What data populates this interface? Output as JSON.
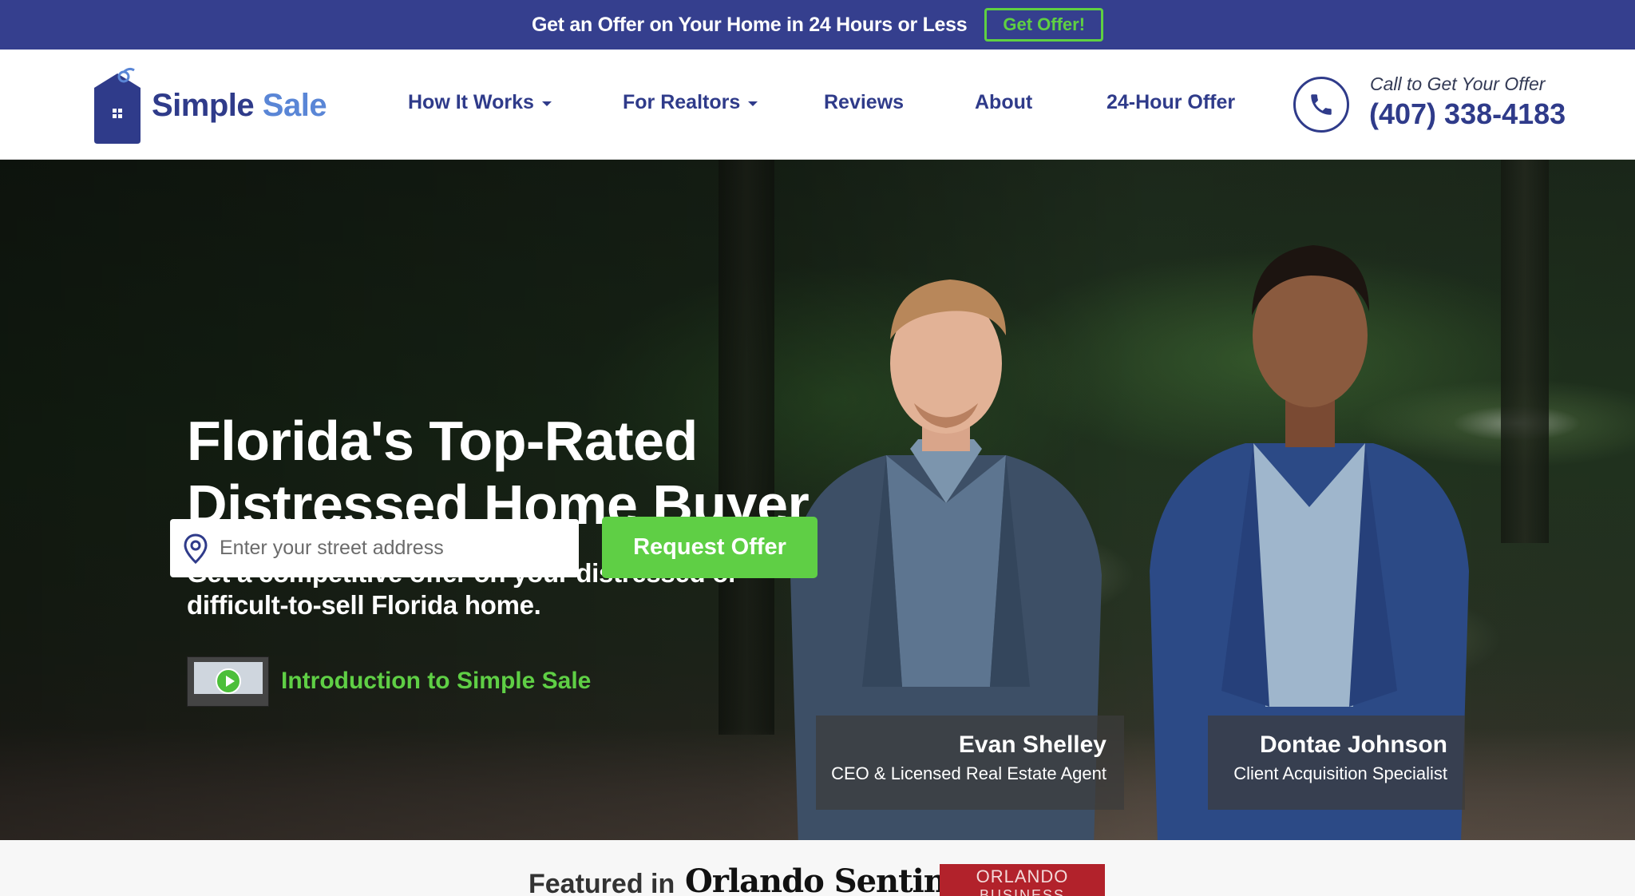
{
  "promo": {
    "text": "Get an Offer on Your Home in 24 Hours or Less",
    "button": "Get Offer!"
  },
  "header": {
    "logo_part1": "Simple",
    "logo_part2": "Sale",
    "nav": [
      {
        "label": "How It Works",
        "dropdown": true
      },
      {
        "label": "For Realtors",
        "dropdown": true
      },
      {
        "label": "Reviews",
        "dropdown": false
      },
      {
        "label": "About",
        "dropdown": false
      },
      {
        "label": "24-Hour Offer",
        "dropdown": false
      }
    ],
    "call_label": "Call to Get Your Offer",
    "phone": "(407) 338-4183"
  },
  "hero": {
    "title": "Florida's Top-Rated Distressed Home Buyer",
    "subtitle": "Get a competitive offer on your distressed or difficult-to-sell Florida home.",
    "address_placeholder": "Enter your street address",
    "request_button": "Request Offer",
    "video_link": "Introduction to Simple Sale",
    "people": [
      {
        "name": "Evan Shelley",
        "role": "CEO & Licensed Real Estate Agent"
      },
      {
        "name": "Dontae Johnson",
        "role": "Client Acquisition Specialist"
      }
    ]
  },
  "featured": {
    "label": "Featured in",
    "outlets": [
      "Orlando Sentinel",
      "ORLANDO",
      "BUSINESS JOURNAL"
    ]
  },
  "colors": {
    "brand_navy": "#353f8e",
    "accent_green": "#5fcf45",
    "logo_blue": "#5a86d6"
  }
}
